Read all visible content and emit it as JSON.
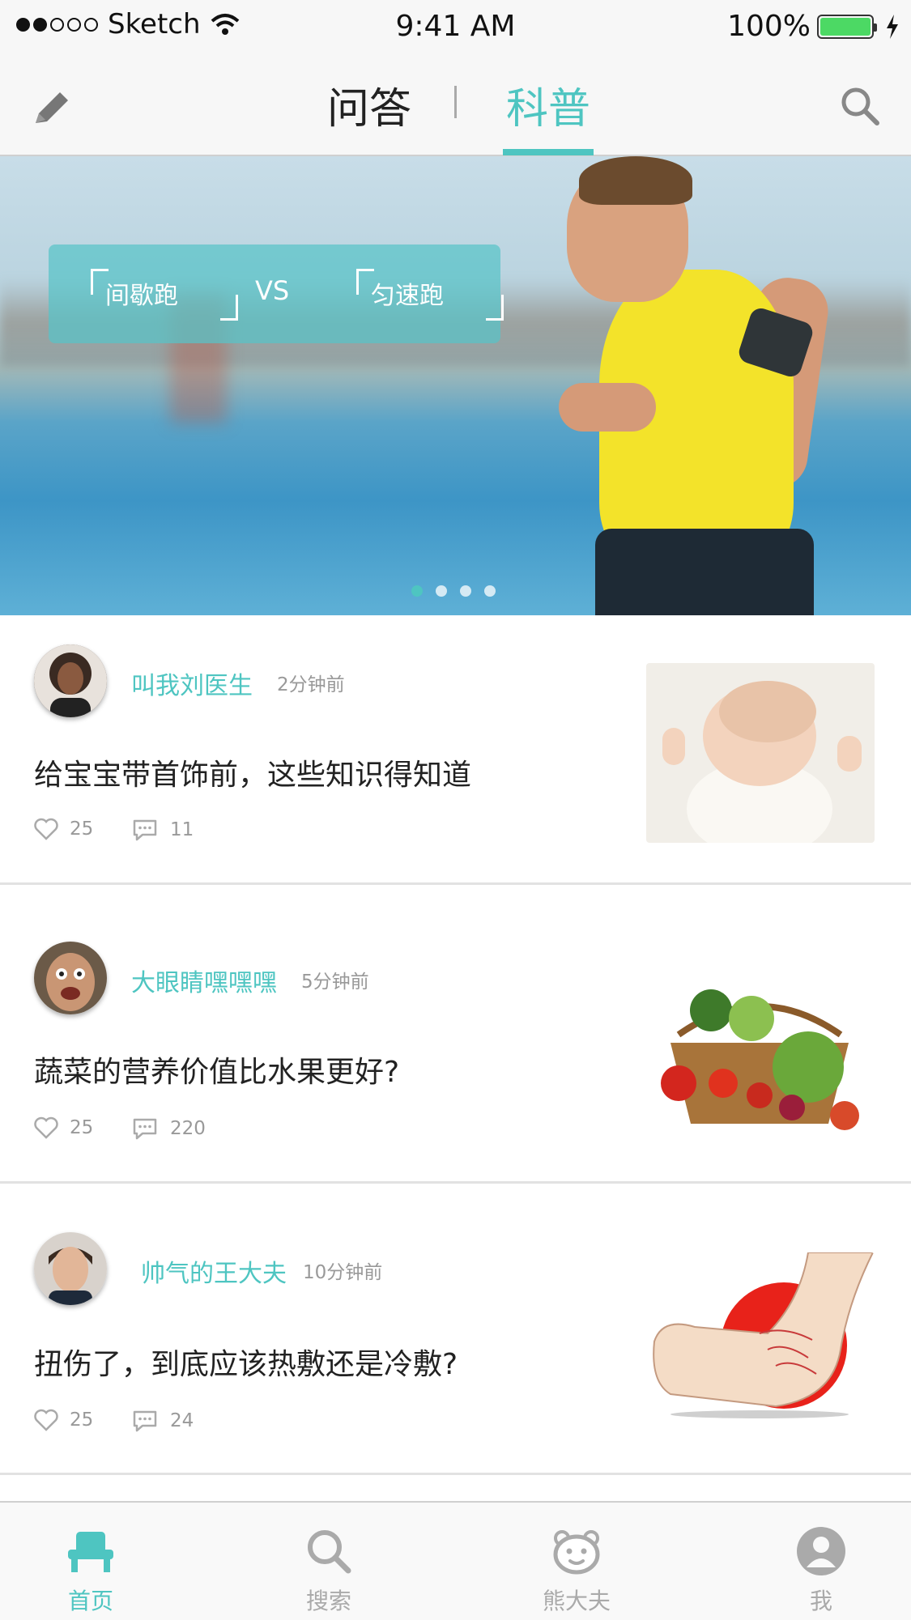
{
  "status_bar": {
    "carrier": "Sketch",
    "time": "9:41 AM",
    "battery": "100%"
  },
  "nav": {
    "tabs": [
      {
        "label": "问答"
      },
      {
        "label": "科普"
      }
    ],
    "active_tab": "科普",
    "accent_color": "#4ec5c1"
  },
  "banner": {
    "left_label": "间歇跑",
    "vs_label": "VS",
    "right_label": "匀速跑",
    "page_count": 4,
    "active_page": 1
  },
  "feed": [
    {
      "author": "叫我刘医生",
      "time": "2分钟前",
      "title": "给宝宝带首饰前，这些知识得知道",
      "likes": "25",
      "comments": "11"
    },
    {
      "author": "大眼睛嘿嘿嘿",
      "time": "5分钟前",
      "title": "蔬菜的营养价值比水果更好?",
      "likes": "25",
      "comments": "220"
    },
    {
      "author": "帅气的王大夫",
      "time": "10分钟前",
      "title": "扭伤了，到底应该热敷还是冷敷?",
      "likes": "25",
      "comments": "24"
    }
  ],
  "tab_bar": {
    "items": [
      {
        "label": "首页",
        "icon": "home-chair-icon"
      },
      {
        "label": "搜索",
        "icon": "search-icon"
      },
      {
        "label": "熊大夫",
        "icon": "bear-doctor-icon"
      },
      {
        "label": "我",
        "icon": "profile-icon"
      }
    ],
    "active": "首页"
  }
}
